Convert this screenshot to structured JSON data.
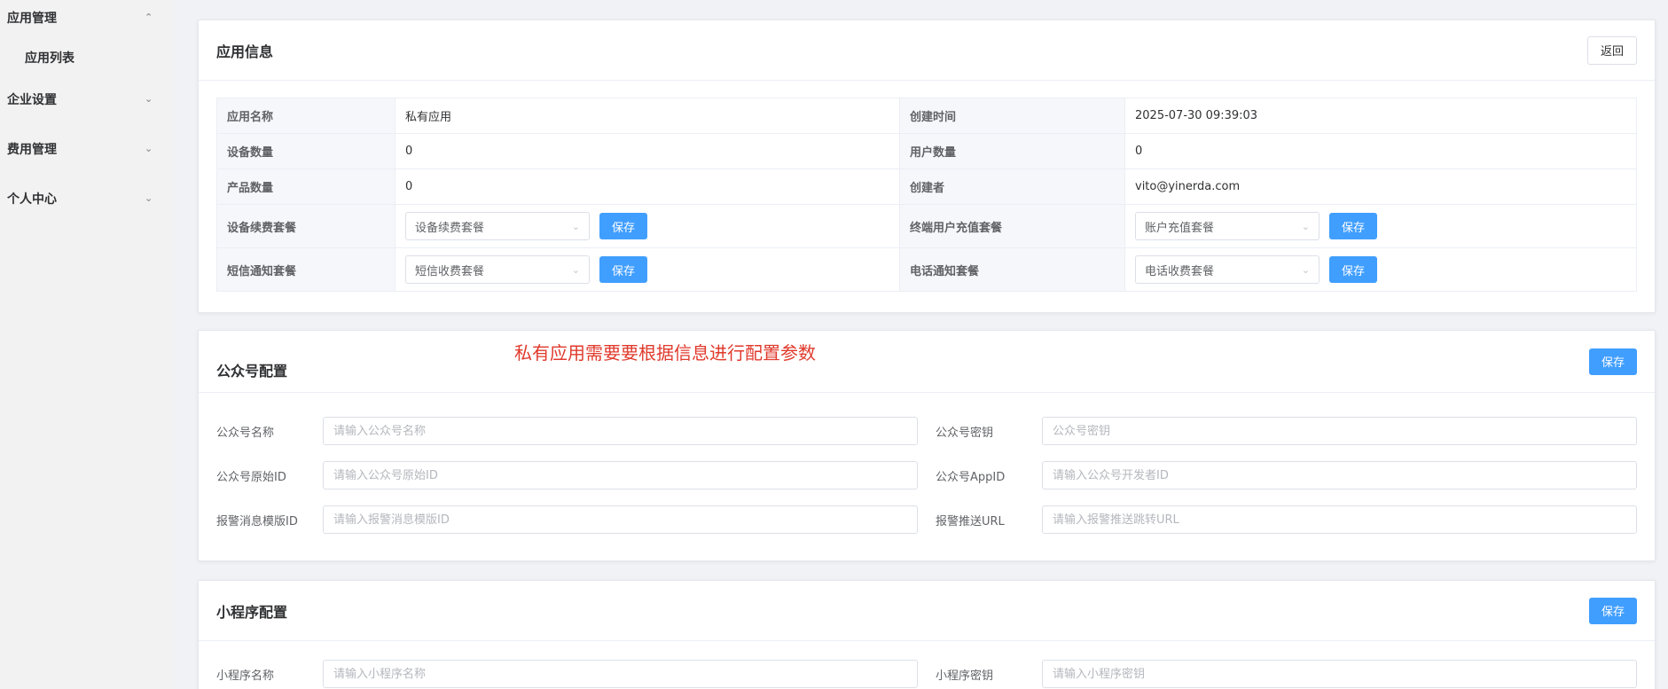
{
  "sidebar": {
    "groups": [
      {
        "label": "应用管理",
        "expanded": true
      },
      {
        "label": "企业设置",
        "expanded": false
      },
      {
        "label": "费用管理",
        "expanded": false
      },
      {
        "label": "个人中心",
        "expanded": false
      }
    ],
    "sub_items": [
      {
        "label": "应用列表"
      }
    ]
  },
  "app_info": {
    "title": "应用信息",
    "back_label": "返回",
    "rows": [
      {
        "l1": "应用名称",
        "v1": "私有应用",
        "l2": "创建时间",
        "v2": "2025-07-30 09:39:03"
      },
      {
        "l1": "设备数量",
        "v1": "0",
        "l2": "用户数量",
        "v2": "0"
      },
      {
        "l1": "产品数量",
        "v1": "0",
        "l2": "创建者",
        "v2": "vito@yinerda.com"
      }
    ],
    "package_rows": [
      {
        "l1": "设备续费套餐",
        "s1": "设备续费套餐",
        "l2": "终端用户充值套餐",
        "s2": "账户充值套餐"
      },
      {
        "l1": "短信通知套餐",
        "s1": "短信收费套餐",
        "l2": "电话通知套餐",
        "s2": "电话收费套餐"
      }
    ],
    "save_label": "保存"
  },
  "annotation": "私有应用需要要根据信息进行配置参数",
  "wechat_config": {
    "title": "公众号配置",
    "save_label": "保存",
    "fields": [
      {
        "label": "公众号名称",
        "placeholder": "请输入公众号名称"
      },
      {
        "label": "公众号密钥",
        "placeholder": "公众号密钥"
      },
      {
        "label": "公众号原始ID",
        "placeholder": "请输入公众号原始ID"
      },
      {
        "label": "公众号AppID",
        "placeholder": "请输入公众号开发者ID"
      },
      {
        "label": "报警消息模版ID",
        "placeholder": "请输入报警消息模版ID"
      },
      {
        "label": "报警推送URL",
        "placeholder": "请输入报警推送跳转URL"
      }
    ]
  },
  "mini_config": {
    "title": "小程序配置",
    "save_label": "保存",
    "fields": [
      {
        "label": "小程序名称",
        "placeholder": "请输入小程序名称"
      },
      {
        "label": "小程序密钥",
        "placeholder": "请输入小程序密钥"
      }
    ]
  },
  "colors": {
    "primary": "#409eff",
    "annotation": "#e03a2c"
  }
}
